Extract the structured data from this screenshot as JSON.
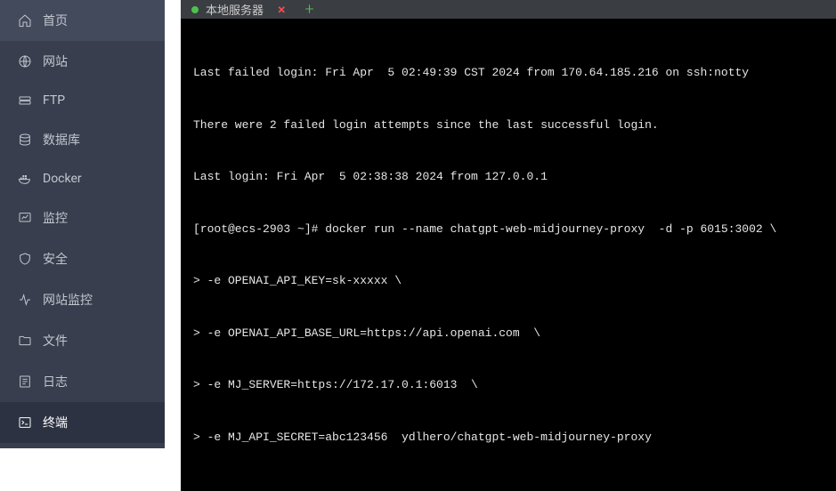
{
  "sidebar": {
    "items": [
      {
        "id": "home",
        "label": "首页"
      },
      {
        "id": "website",
        "label": "网站"
      },
      {
        "id": "ftp",
        "label": "FTP"
      },
      {
        "id": "database",
        "label": "数据库"
      },
      {
        "id": "docker",
        "label": "Docker"
      },
      {
        "id": "monitor",
        "label": "监控"
      },
      {
        "id": "security",
        "label": "安全"
      },
      {
        "id": "site-monitor",
        "label": "网站监控"
      },
      {
        "id": "files",
        "label": "文件"
      },
      {
        "id": "logs",
        "label": "日志"
      },
      {
        "id": "terminal",
        "label": "终端"
      }
    ],
    "active_id": "terminal"
  },
  "tabs": {
    "items": [
      {
        "label": "本地服务器",
        "status": "running"
      }
    ],
    "add_label": "+"
  },
  "terminal": {
    "lines": [
      "Last failed login: Fri Apr  5 02:49:39 CST 2024 from 170.64.185.216 on ssh:notty",
      "There were 2 failed login attempts since the last successful login.",
      "Last login: Fri Apr  5 02:38:38 2024 from 127.0.0.1",
      "[root@ecs-2903 ~]# docker run --name chatgpt-web-midjourney-proxy  -d -p 6015:3002 \\",
      "> -e OPENAI_API_KEY=sk-xxxxx \\",
      "> -e OPENAI_API_BASE_URL=https://api.openai.com  \\",
      "> -e MJ_SERVER=https://172.17.0.1:6013  \\",
      "> -e MJ_API_SECRET=abc123456  ydlhero/chatgpt-web-midjourney-proxy"
    ]
  }
}
